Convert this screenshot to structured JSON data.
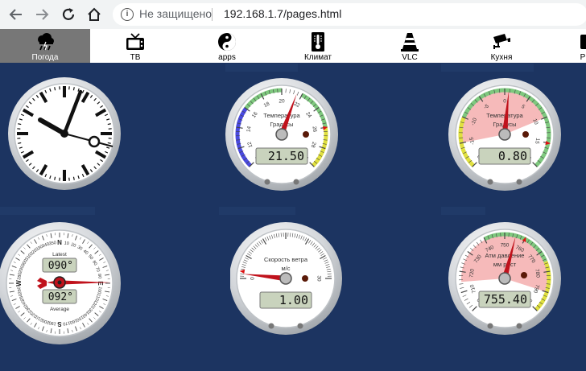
{
  "browser": {
    "security_label": "Не защищено",
    "url": "192.168.1.7/pages.html"
  },
  "nav": {
    "items": [
      {
        "label": "Погода",
        "icon": "weather-icon",
        "active": true
      },
      {
        "label": "ТВ",
        "icon": "tv-icon",
        "active": false
      },
      {
        "label": "apps",
        "icon": "yin-yang-icon",
        "active": false
      },
      {
        "label": "Климат",
        "icon": "thermometer-icon",
        "active": false
      },
      {
        "label": "VLC",
        "icon": "traffic-cone-icon",
        "active": false
      },
      {
        "label": "Кухня",
        "icon": "camera-icon",
        "active": false
      },
      {
        "label": "Р",
        "icon": "partial-icon",
        "active": false
      }
    ]
  },
  "gauges": {
    "temperature": {
      "title": "Температура",
      "unit": "Градусы",
      "display": "21.50",
      "value": 21.5,
      "min": 10,
      "max": 30,
      "ticks": [
        "10",
        "12",
        "14",
        "16",
        "18",
        "20",
        "22",
        "24",
        "26",
        "28",
        "30"
      ]
    },
    "outdoor": {
      "title": "Температура",
      "unit": "Градусы",
      "display": "0.80",
      "value": 0.8,
      "min": -20,
      "max": 20,
      "ticks": [
        "-20",
        "-15",
        "-10",
        "-5",
        "0",
        "5",
        "10",
        "15",
        "20"
      ]
    },
    "wind_direction": {
      "latest_label": "Latest",
      "latest_value": "090°",
      "average_label": "Average",
      "average_value": "092°",
      "cardinals": [
        "N",
        "E",
        "S",
        "W"
      ],
      "ticks": [
        "10",
        "20",
        "30",
        "40",
        "50",
        "60",
        "70",
        "80",
        "100",
        "110",
        "120",
        "130",
        "140",
        "150",
        "160",
        "170",
        "190",
        "200",
        "210",
        "220",
        "230",
        "240",
        "250",
        "260",
        "280",
        "290",
        "300",
        "310",
        "320",
        "330",
        "340",
        "350"
      ],
      "latest_deg": 90
    },
    "wind_speed": {
      "title": "Скорость ветра",
      "unit": "м/с",
      "display": "1.00",
      "value": 1.0,
      "min": 0,
      "max": 30,
      "ticks": [
        "0",
        "30"
      ]
    },
    "pressure": {
      "title": "Атм давление",
      "unit": "мм рт.ст",
      "display": "755.40",
      "value": 755.4,
      "min": 700,
      "max": 800,
      "ticks": [
        "700",
        "710",
        "720",
        "730",
        "740",
        "750",
        "760",
        "770",
        "780",
        "790",
        "800"
      ]
    }
  },
  "colors": {
    "background": "#1c3461",
    "needle": "#c0121c",
    "lcd": "#c9d3bd"
  }
}
